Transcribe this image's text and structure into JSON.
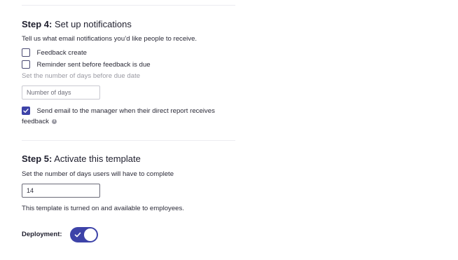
{
  "step4": {
    "step_label": "Step 4:",
    "title": "Set up notifications",
    "description": "Tell us what email notifications you’d like people to receive.",
    "checkbox_feedback_create": {
      "label": "Feedback create",
      "checked": false
    },
    "checkbox_reminder": {
      "label": "Reminder sent before feedback is due",
      "checked": false
    },
    "days_hint": "Set the number of days before due date",
    "days_input": {
      "placeholder": "Number of days",
      "value": ""
    },
    "checkbox_manager_email": {
      "label_line1": "Send email to the manager when their direct report receives",
      "label_line2": "feedback",
      "checked": true,
      "info_icon": "info-icon"
    }
  },
  "step5": {
    "step_label": "Step 5:",
    "title": "Activate this template",
    "description": "Set the number of days users will have to complete",
    "days_input": {
      "value": "14"
    },
    "status_text": "This template is turned on and available to employees.",
    "deployment_label": "Deployment:",
    "deployment_enabled": true
  },
  "colors": {
    "accent": "#3d43a8",
    "muted_text": "#9a9aa3"
  }
}
